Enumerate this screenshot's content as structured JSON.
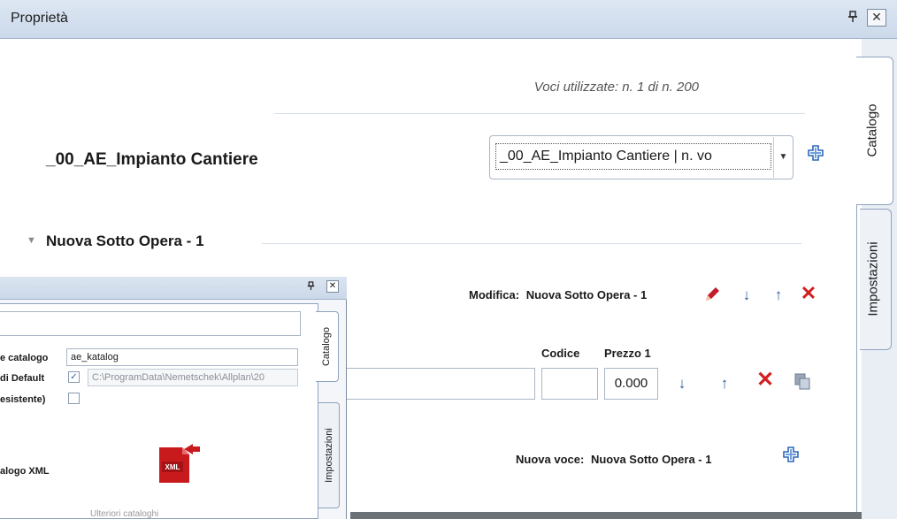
{
  "window": {
    "title": "Proprietà",
    "pin_glyph": "ᵖ",
    "close_glyph": "✕"
  },
  "tabs": {
    "catalogo": "Catalogo",
    "impostazioni": "Impostazioni"
  },
  "summary": "Voci utilizzate:  n. 1   di   n. 200",
  "catalog": {
    "title": "_00_AE_Impianto Cantiere",
    "selected": "_00_AE_Impianto Cantiere | n. vo"
  },
  "section": {
    "title": "Nuova Sotto Opera - 1"
  },
  "modifica": {
    "label": "Modifica:",
    "value": "Nuova Sotto Opera - 1"
  },
  "table": {
    "col_codice": "Codice",
    "col_prezzo": "Prezzo 1",
    "prezzo_value": "0.000"
  },
  "nuova_voce": {
    "label": "Nuova voce:",
    "value": "Nuova Sotto Opera - 1"
  },
  "overlay": {
    "tabs": {
      "catalogo": "Catalogo",
      "impostazioni": "Impostazioni"
    },
    "label_catalogo": "e catalogo",
    "value_catalogo": "ae_katalog",
    "label_default": "di Default",
    "value_path": "C:\\ProgramData\\Nemetschek\\Allplan\\20",
    "label_esistente": "esistente)",
    "label_xml": "alogo XML",
    "xml_icon_text": "XML",
    "bottom_text": "Ulteriori  cataloghi"
  }
}
